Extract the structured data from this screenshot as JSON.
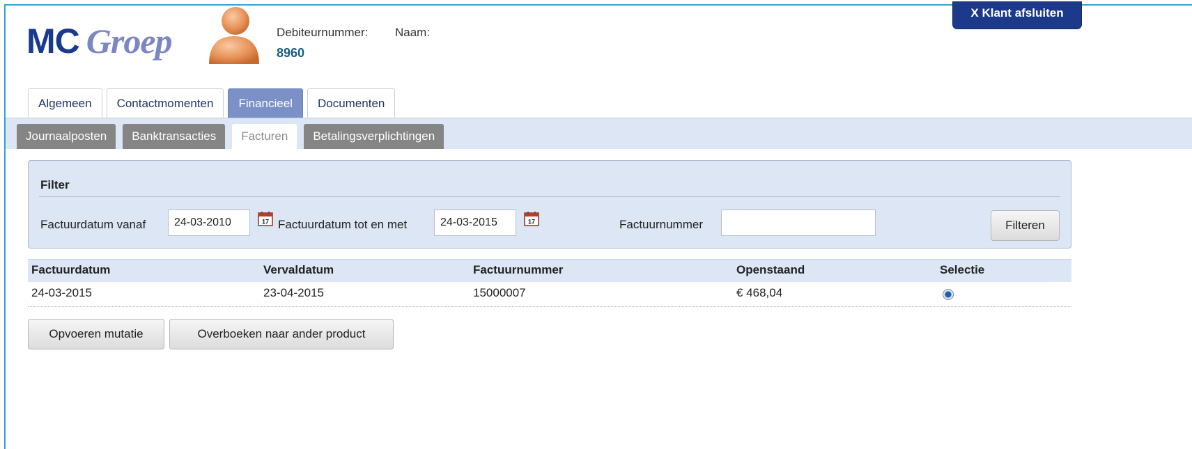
{
  "header": {
    "logo_mc": "MC",
    "logo_groep": "Groep",
    "debiteur_label": "Debiteurnummer:",
    "naam_label": "Naam:",
    "debiteur_value": "8960",
    "close_label": "X Klant afsluiten"
  },
  "main_tabs": [
    {
      "label": "Algemeen",
      "active": false
    },
    {
      "label": "Contactmomenten",
      "active": false
    },
    {
      "label": "Financieel",
      "active": true
    },
    {
      "label": "Documenten",
      "active": false
    }
  ],
  "sub_tabs": [
    {
      "label": "Journaalposten",
      "active": false
    },
    {
      "label": "Banktransacties",
      "active": false
    },
    {
      "label": "Facturen",
      "active": true
    },
    {
      "label": "Betalingsverplichtingen",
      "active": false
    }
  ],
  "filter": {
    "title": "Filter",
    "from_label": "Factuurdatum vanaf",
    "from_value": "24-03-2010",
    "to_label": "Factuurdatum tot en met",
    "to_value": "24-03-2015",
    "number_label": "Factuurnummer",
    "number_value": "",
    "button_label": "Filteren",
    "calendar_day": "17"
  },
  "table": {
    "headers": [
      "Factuurdatum",
      "Vervaldatum",
      "Factuurnummer",
      "Openstaand",
      "Selectie"
    ],
    "rows": [
      {
        "factuurdatum": "24-03-2015",
        "vervaldatum": "23-04-2015",
        "factuurnummer": "15000007",
        "openstaand": "€ 468,04",
        "selected": true
      }
    ]
  },
  "actions": {
    "mutatie_label": "Opvoeren mutatie",
    "overboeken_label": "Overboeken naar ander product"
  },
  "colors": {
    "brand_dark": "#1a3a8c",
    "brand_light": "#7b86c4",
    "active_tab": "#7b90c6",
    "panel_bg": "#dde6f4",
    "subtab_bg": "#858585",
    "person_icon": "#e8935a"
  }
}
